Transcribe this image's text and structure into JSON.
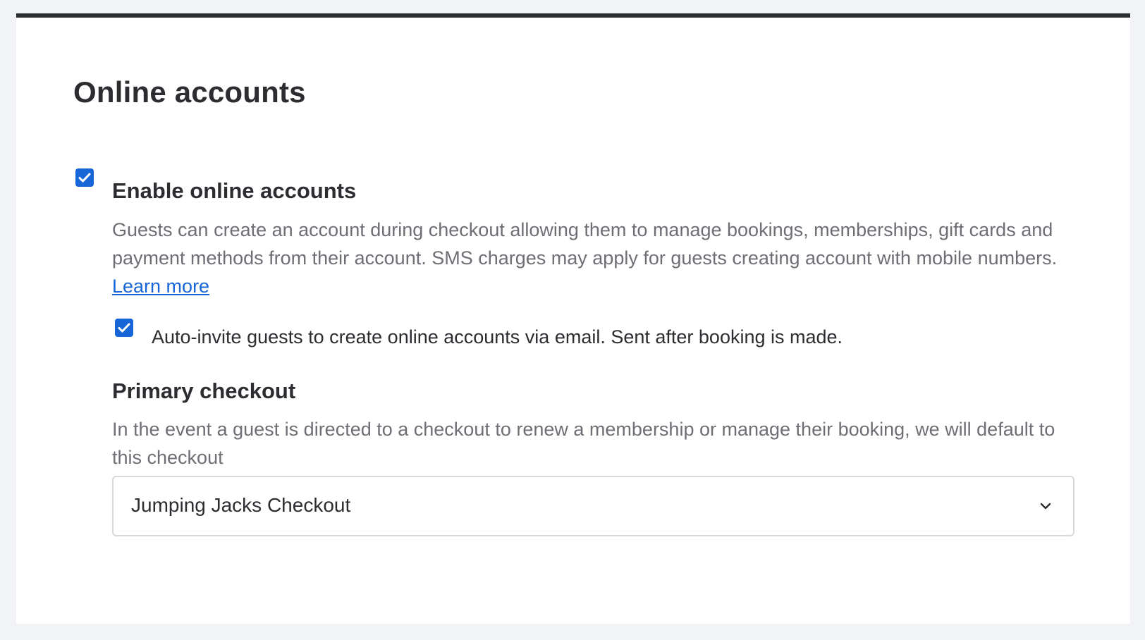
{
  "section": {
    "title": "Online accounts"
  },
  "enable_online_accounts": {
    "label": "Enable online accounts",
    "checked": true,
    "description": "Guests can create an account during checkout allowing them to manage bookings, memberships, gift cards and payment methods from their account. SMS charges may apply for guests creating account with mobile numbers. ",
    "learn_more_label": "Learn more"
  },
  "auto_invite": {
    "label": "Auto-invite guests to create online accounts via email. Sent after booking is made.",
    "checked": true
  },
  "primary_checkout": {
    "title": "Primary checkout",
    "description": "In the event a guest is directed to a checkout to renew a membership or manage their booking, we will default to this checkout",
    "selected_value": "Jumping Jacks Checkout"
  },
  "colors": {
    "accent": "#1766d8",
    "text_primary": "#2b2d31",
    "text_secondary": "#6d6f75",
    "page_background": "#f2f3f7",
    "card_top_border": "#2b2d31"
  },
  "icons": {
    "checkbox_check": "check-icon",
    "select_chevron": "chevron-down-icon"
  }
}
